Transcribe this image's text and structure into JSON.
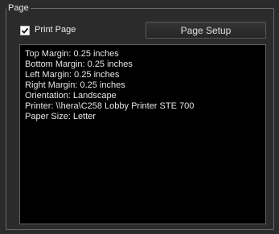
{
  "group": {
    "title": "Page"
  },
  "print_page": {
    "label": "Print Page",
    "checked": true
  },
  "page_setup_button": {
    "label": "Page Setup"
  },
  "page_info": {
    "lines": [
      "Top Margin: 0.25 inches",
      "Bottom Margin: 0.25 inches",
      "Left Margin: 0.25 inches",
      "Right Margin: 0.25 inches",
      "Orientation: Landscape",
      "Printer: \\\\hera\\C258 Lobby Printer STE 700",
      "Paper Size: Letter"
    ]
  },
  "colors": {
    "background": "#2b2b2b",
    "panel": "#000000",
    "text": "#e8e8e8",
    "border": "#6a6a6a"
  },
  "icons": {
    "checkbox": "checkmark-icon"
  }
}
